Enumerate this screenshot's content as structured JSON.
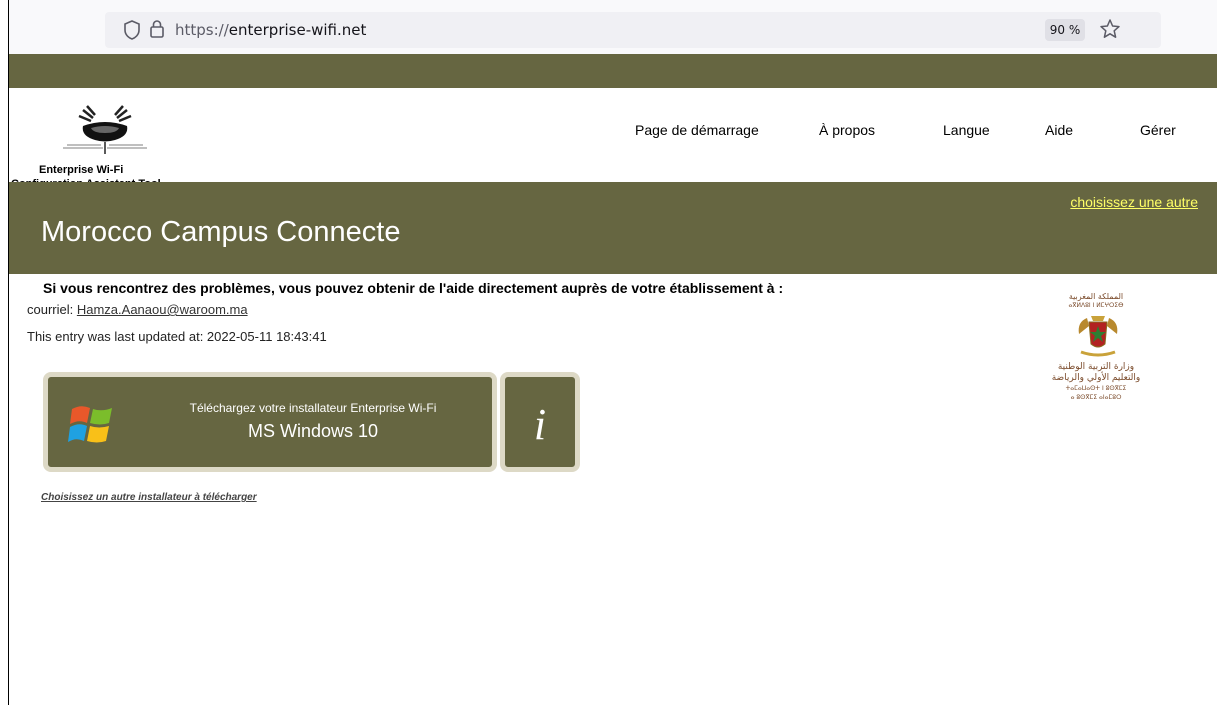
{
  "browser": {
    "url_scheme": "https://",
    "url_host": "enterprise-wifi.net",
    "zoom": "90 %",
    "icons": [
      "shield-icon",
      "lock-icon",
      "bookmark-star-icon"
    ]
  },
  "header": {
    "logo_title": "Enterprise Wi-Fi",
    "logo_subtitle": "Configuration Assistant Tool",
    "nav": [
      "Page de démarrage",
      "À propos",
      "Langue",
      "Aide",
      "Gérer"
    ]
  },
  "banner": {
    "title": "Morocco Campus Connecte",
    "choose_other": "choisissez une autre"
  },
  "content": {
    "help_heading": "Si vous rencontrez des problèmes, vous pouvez obtenir de l'aide directement auprès de votre établissement à :",
    "email_label": "courriel: ",
    "email": "Hamza.Aanaou@waroom.ma",
    "updated": "This entry was last updated at: 2022-05-11 18:43:41",
    "download_caption": "Téléchargez votre installateur Enterprise Wi-Fi",
    "download_os": "MS Windows 10",
    "info_label": "i",
    "other_installer": "Choisissez un autre installateur à télécharger"
  },
  "institution": {
    "line1": "المملكة المغربية",
    "line2": "ⴰⴳⵍⴷⵓⵏ ⵏ ⵍⵎⵖⵔⵉⴱ",
    "line3": "وزارة التربية الوطنية",
    "line4": "والتعليم الأولي والرياضة",
    "line5": "ⵜⴰⵎⴰⵡⴰⵙⵜ ⵏ ⵓⵙⴳⵎⵉ",
    "line6": "ⴰ ⵓⵙⴳⵎⵉ ⴰⵏⴰⵎⵓⵔ"
  },
  "colors": {
    "olive": "#666641",
    "button_border": "#ddd9c6",
    "link_yellow": "#ffff66"
  }
}
